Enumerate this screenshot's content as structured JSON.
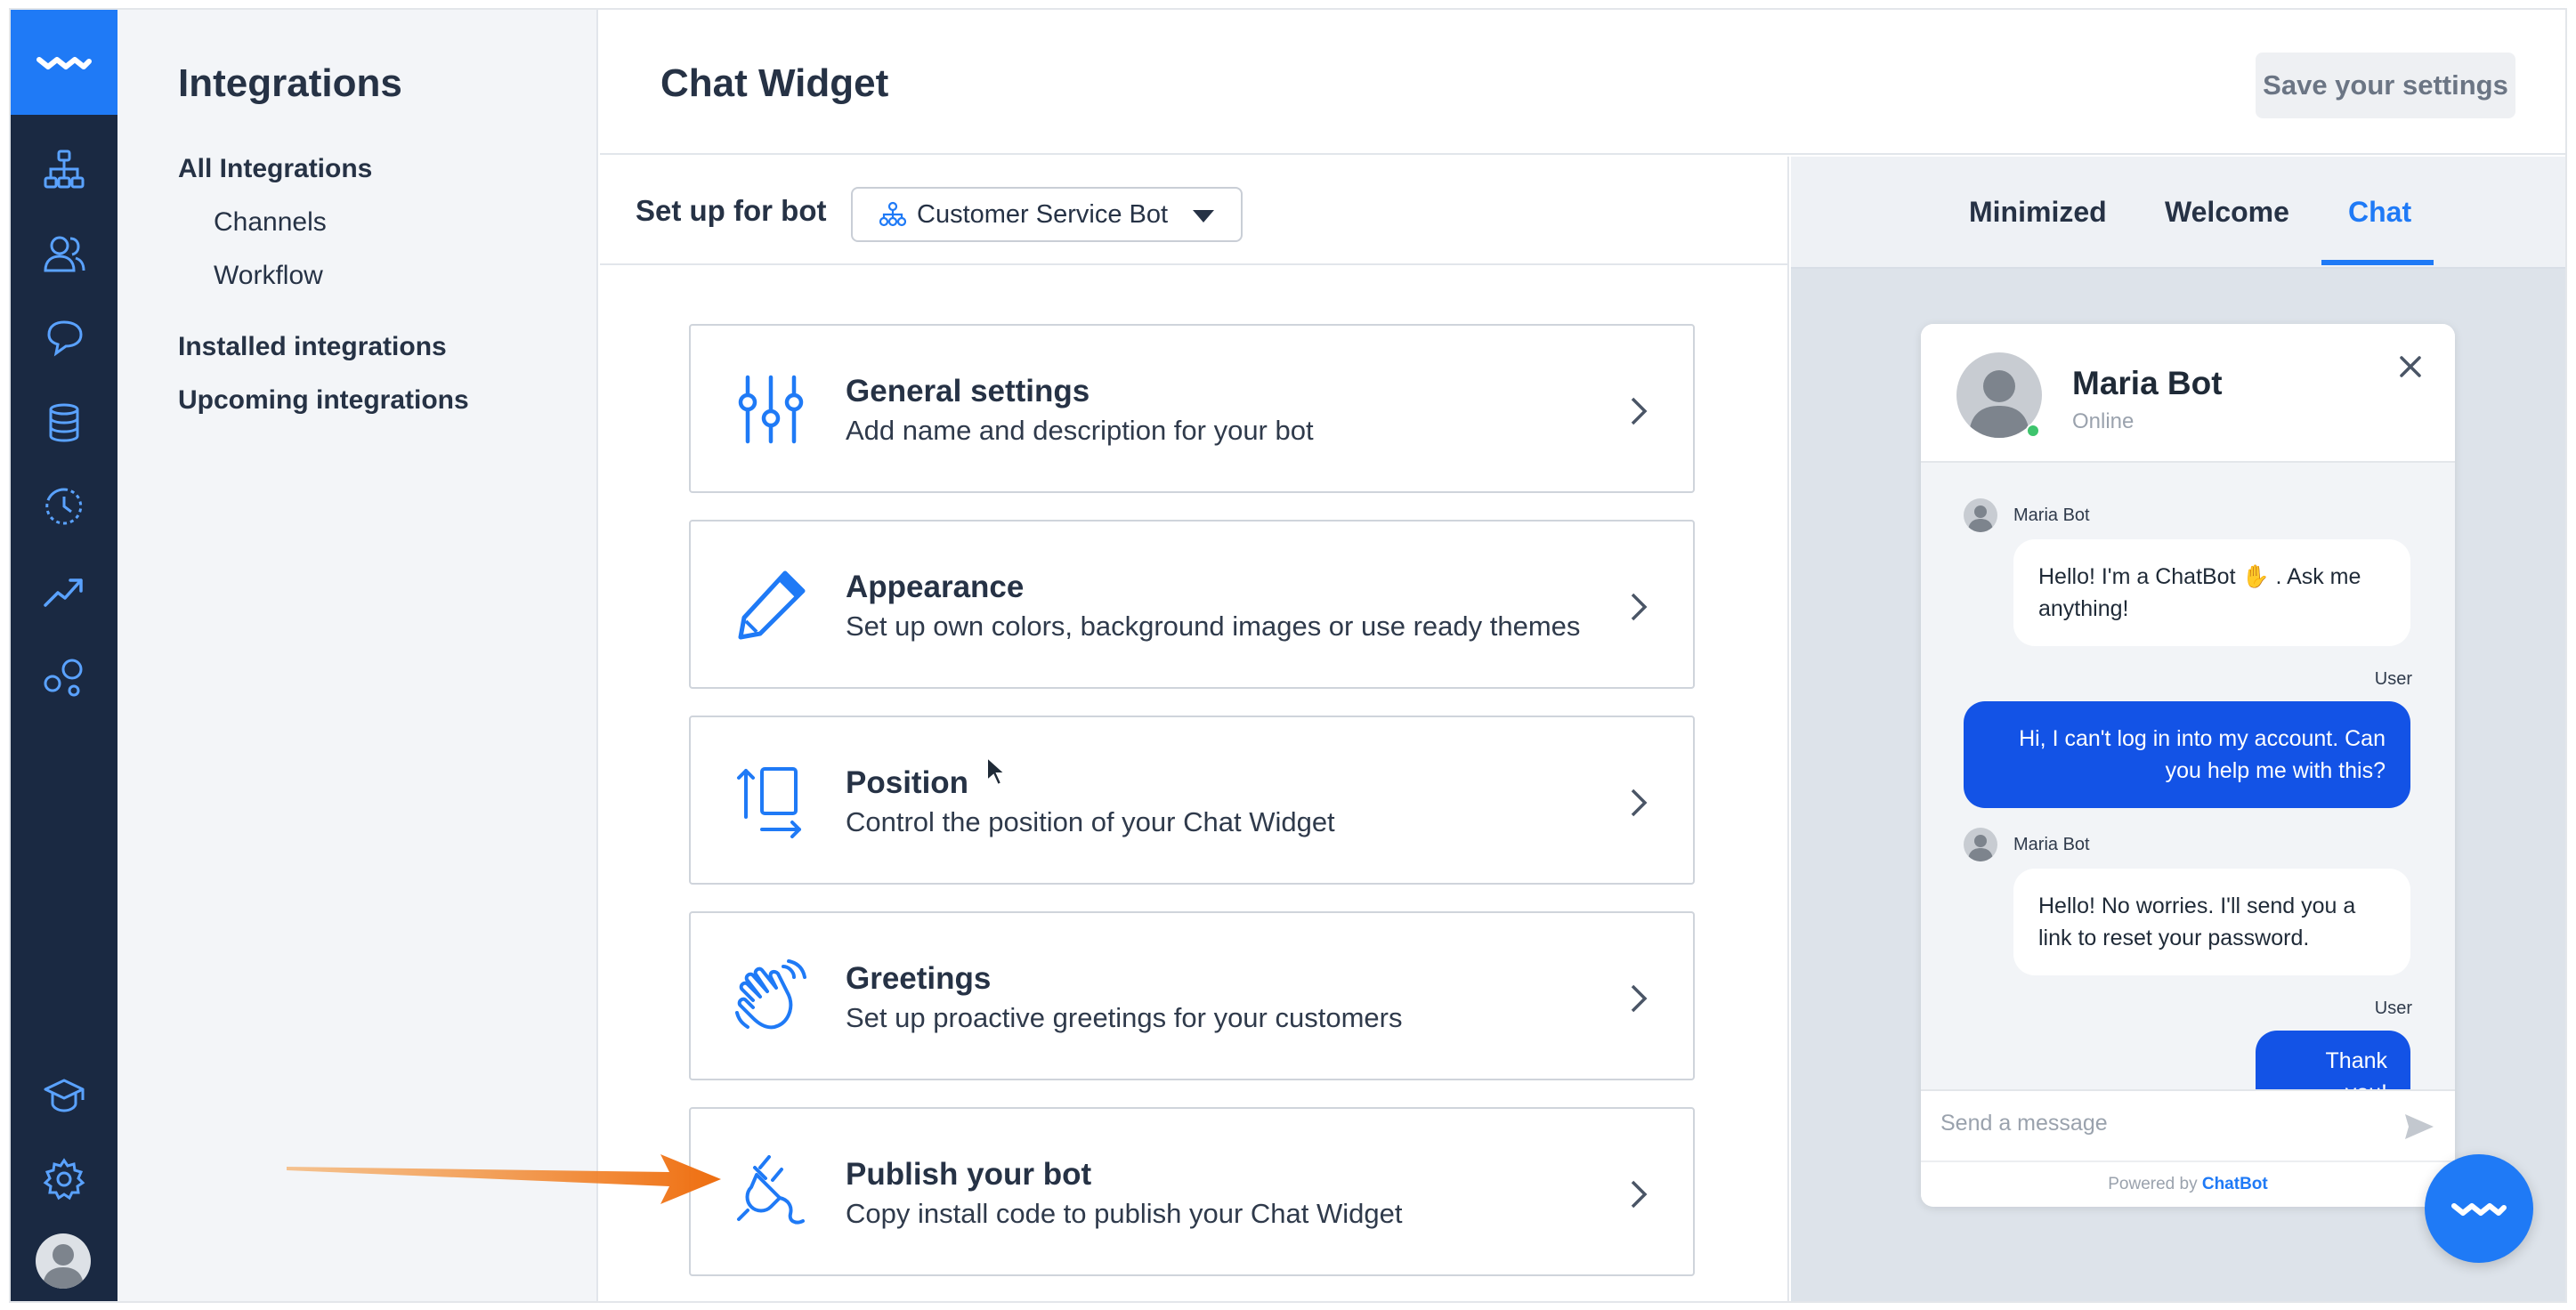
{
  "sidebar_nav": {
    "icons": [
      "logo-wave-icon",
      "bot-hierarchy-icon",
      "users-icon",
      "chat-bubble-icon",
      "database-icon",
      "clock-history-icon",
      "trending-up-icon",
      "integrations-bubbles-icon",
      "academy-cap-icon",
      "settings-gear-icon",
      "user-avatar"
    ]
  },
  "integrations_panel": {
    "title": "Integrations",
    "links": [
      {
        "label": "All Integrations"
      },
      {
        "label": "Channels"
      },
      {
        "label": "Workflow"
      },
      {
        "label": "Installed integrations"
      },
      {
        "label": "Upcoming integrations"
      }
    ]
  },
  "header": {
    "title": "Chat Widget",
    "save_label": "Save your settings"
  },
  "setup": {
    "label": "Set up for bot",
    "selected_bot": "Customer Service Bot"
  },
  "cards": [
    {
      "title": "General settings",
      "desc": "Add name and description for your bot"
    },
    {
      "title": "Appearance",
      "desc": "Set up own colors, background images or use ready themes"
    },
    {
      "title": "Position",
      "desc": "Control the position of your Chat Widget"
    },
    {
      "title": "Greetings",
      "desc": "Set up proactive greetings for your customers"
    },
    {
      "title": "Publish your bot",
      "desc": "Copy install code to publish your Chat Widget"
    }
  ],
  "preview_tabs": [
    {
      "label": "Minimized"
    },
    {
      "label": "Welcome"
    },
    {
      "label": "Chat",
      "active": true
    }
  ],
  "widget": {
    "bot_name": "Maria Bot",
    "status": "Online",
    "messages": [
      {
        "from": "Maria Bot",
        "text": "Hello! I'm a ChatBot ✋ . Ask me anything!"
      },
      {
        "from": "User",
        "text": "Hi, I can't log in into my account. Can you help me with this?"
      },
      {
        "from": "Maria Bot",
        "text": "Hello! No worries. I'll send you a link to reset your password."
      },
      {
        "from": "User",
        "text": "Thank you!"
      }
    ],
    "input_placeholder": "Send a message",
    "footer_prefix": "Powered by ",
    "footer_brand": "ChatBot"
  },
  "colors": {
    "accent": "#1f7af6",
    "rail": "#1a2942",
    "user_bubble": "#1353e6",
    "annotation_arrow": "#f07d1a",
    "online": "#3ec46d"
  }
}
